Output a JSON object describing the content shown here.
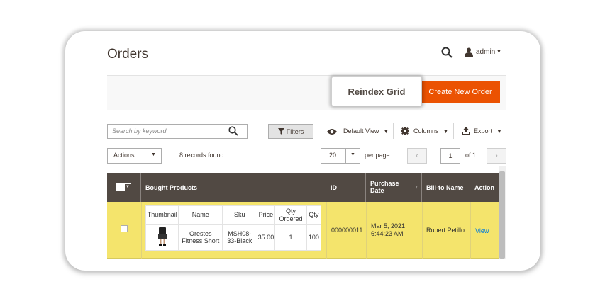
{
  "header": {
    "title": "Orders",
    "user": "admin"
  },
  "actions": {
    "reindex_label": "Reindex Grid",
    "create_label": "Create New Order"
  },
  "toolbar": {
    "search_placeholder": "Search by keyword",
    "filters_label": "Filters",
    "view_label": "Default View",
    "columns_label": "Columns",
    "export_label": "Export"
  },
  "pager": {
    "actions_label": "Actions",
    "records_found": "8 records found",
    "per_page_value": "20",
    "per_page_label": "per page",
    "prev": "‹",
    "page": "1",
    "of_pages": "of 1",
    "next": "›"
  },
  "grid": {
    "columns": {
      "bought_products": "Bought Products",
      "id": "ID",
      "purchase_date": "Purchase Date",
      "sort_arrow": "↑",
      "bill_to": "Bill-to Name",
      "action": "Action"
    },
    "inner_headers": {
      "thumbnail": "Thumbnail",
      "name": "Name",
      "sku": "Sku",
      "price": "Price",
      "qty_ordered": "Qty Ordered",
      "qty": "Qty"
    },
    "row": {
      "product_name": "Orestes Fitness Short",
      "sku": "MSH08-33-Black",
      "price": "35.00",
      "qty_ordered": "1",
      "qty": "100",
      "id": "000000011",
      "purchase_date": "Mar 5, 2021 6:44:23 AM",
      "bill_to": "Rupert Petillo",
      "action": "View"
    }
  },
  "colors": {
    "accent": "#eb5202",
    "header_bg": "#514943",
    "highlight_row": "#f4e46c",
    "link": "#007bdb"
  }
}
